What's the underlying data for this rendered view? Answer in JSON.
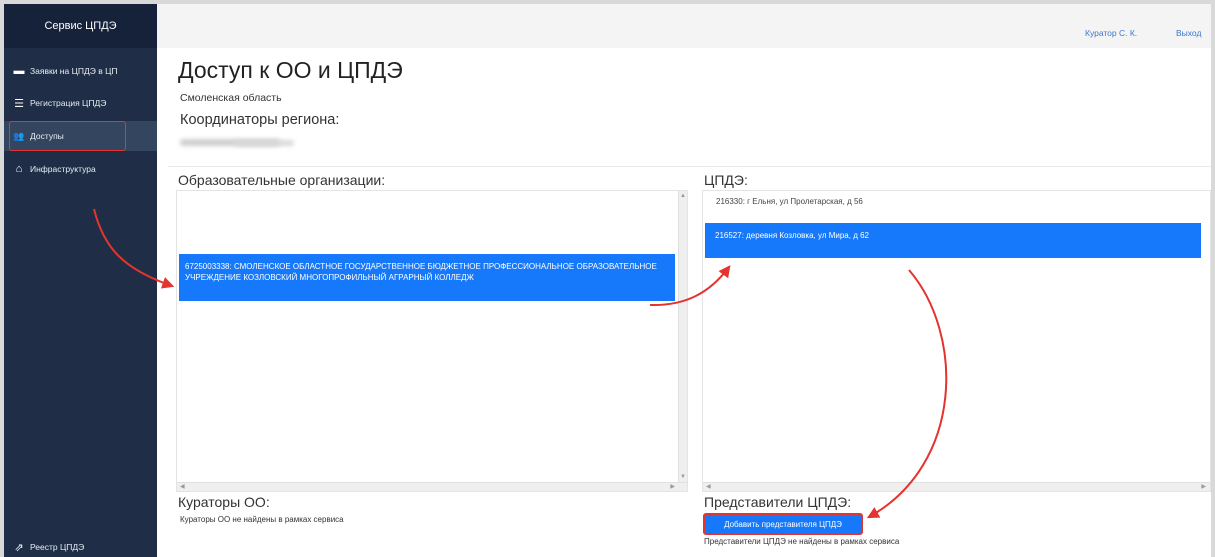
{
  "sidebar": {
    "brand": "Сервис ЦПДЭ",
    "items": [
      {
        "label": "Заявки на ЦПДЭ в ЦП",
        "icon": "briefcase-icon",
        "glyph": "▬"
      },
      {
        "label": "Регистрация ЦПДЭ",
        "icon": "list-icon",
        "glyph": "☰"
      },
      {
        "label": "Доступы",
        "icon": "users-icon",
        "glyph": "👥"
      },
      {
        "label": "Инфраструктура",
        "icon": "home-icon",
        "glyph": "⌂"
      }
    ],
    "bottom": {
      "label": "Реестр ЦПДЭ",
      "icon": "external-link-icon",
      "glyph": "⇗"
    }
  },
  "topbar": {
    "user": "Куратор С. К.",
    "logout": "Выход"
  },
  "page": {
    "title": "Доступ к ОО и ЦПДЭ",
    "region": "Смоленская область",
    "coordinators_title": "Координаторы региона:"
  },
  "oo": {
    "title": "Образовательные организации:",
    "selected": "6725003338: СМОЛЕНСКОЕ ОБЛАСТНОЕ ГОСУДАРСТВЕННОЕ БЮДЖЕТНОЕ ПРОФЕССИОНАЛЬНОЕ ОБРАЗОВАТЕЛЬНОЕ УЧРЕЖДЕНИЕ КОЗЛОВСКИЙ МНОГОПРОФИЛЬНЫЙ АГРАРНЫЙ КОЛЛЕДЖ"
  },
  "cpde": {
    "title": "ЦПДЭ:",
    "items": [
      "216330: г Ельня, ул Пролетарская, д 56",
      "216527: деревня Козловка, ул Мира, д 62"
    ]
  },
  "curators": {
    "title": "Кураторы ОО:",
    "empty": "Кураторы ОО не найдены в рамках сервиса"
  },
  "representatives": {
    "title": "Представители ЦПДЭ:",
    "add_button": "Добавить представителя ЦПДЭ",
    "empty": "Представители ЦПДЭ не найдены в рамках сервиса"
  },
  "colors": {
    "accent": "#1678fb",
    "annotation": "#e3342f",
    "sidebar": "#1f2e46"
  }
}
